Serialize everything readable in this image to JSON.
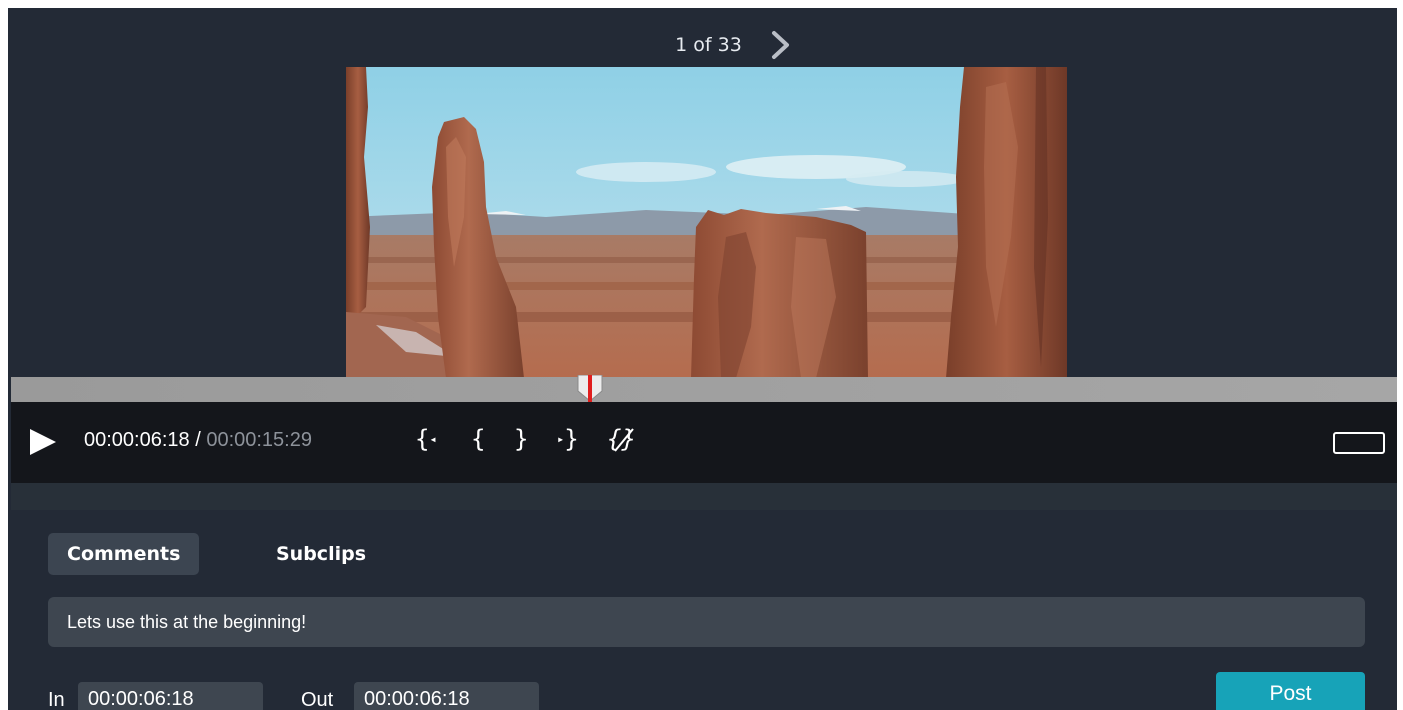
{
  "pager": {
    "text": "1 of 33",
    "next_icon": "chevron-right-icon"
  },
  "player": {
    "current_time": "00:00:06:18",
    "separator": " / ",
    "total_time": "00:00:15:29",
    "playhead_fraction": 0.418,
    "play_icon": "play-icon",
    "controls": {
      "go_to_in": "{",
      "mark_in": "{",
      "mark_out": "}",
      "go_to_out": "}",
      "clear_marks": "{}"
    },
    "fullscreen_icon": "fullscreen-icon"
  },
  "tabs": [
    {
      "label": "Comments",
      "active": true
    },
    {
      "label": "Subclips",
      "active": false
    }
  ],
  "comment": {
    "value": "Lets use this at the beginning!"
  },
  "in_point": {
    "label": "In",
    "value": "00:00:06:18"
  },
  "out_point": {
    "label": "Out",
    "value": "00:00:06:18"
  },
  "post_button": {
    "label": "Post"
  },
  "colors": {
    "background": "#232a36",
    "control_bar": "#14161b",
    "accent": "#17a3b8",
    "playhead": "#e01e1e"
  }
}
